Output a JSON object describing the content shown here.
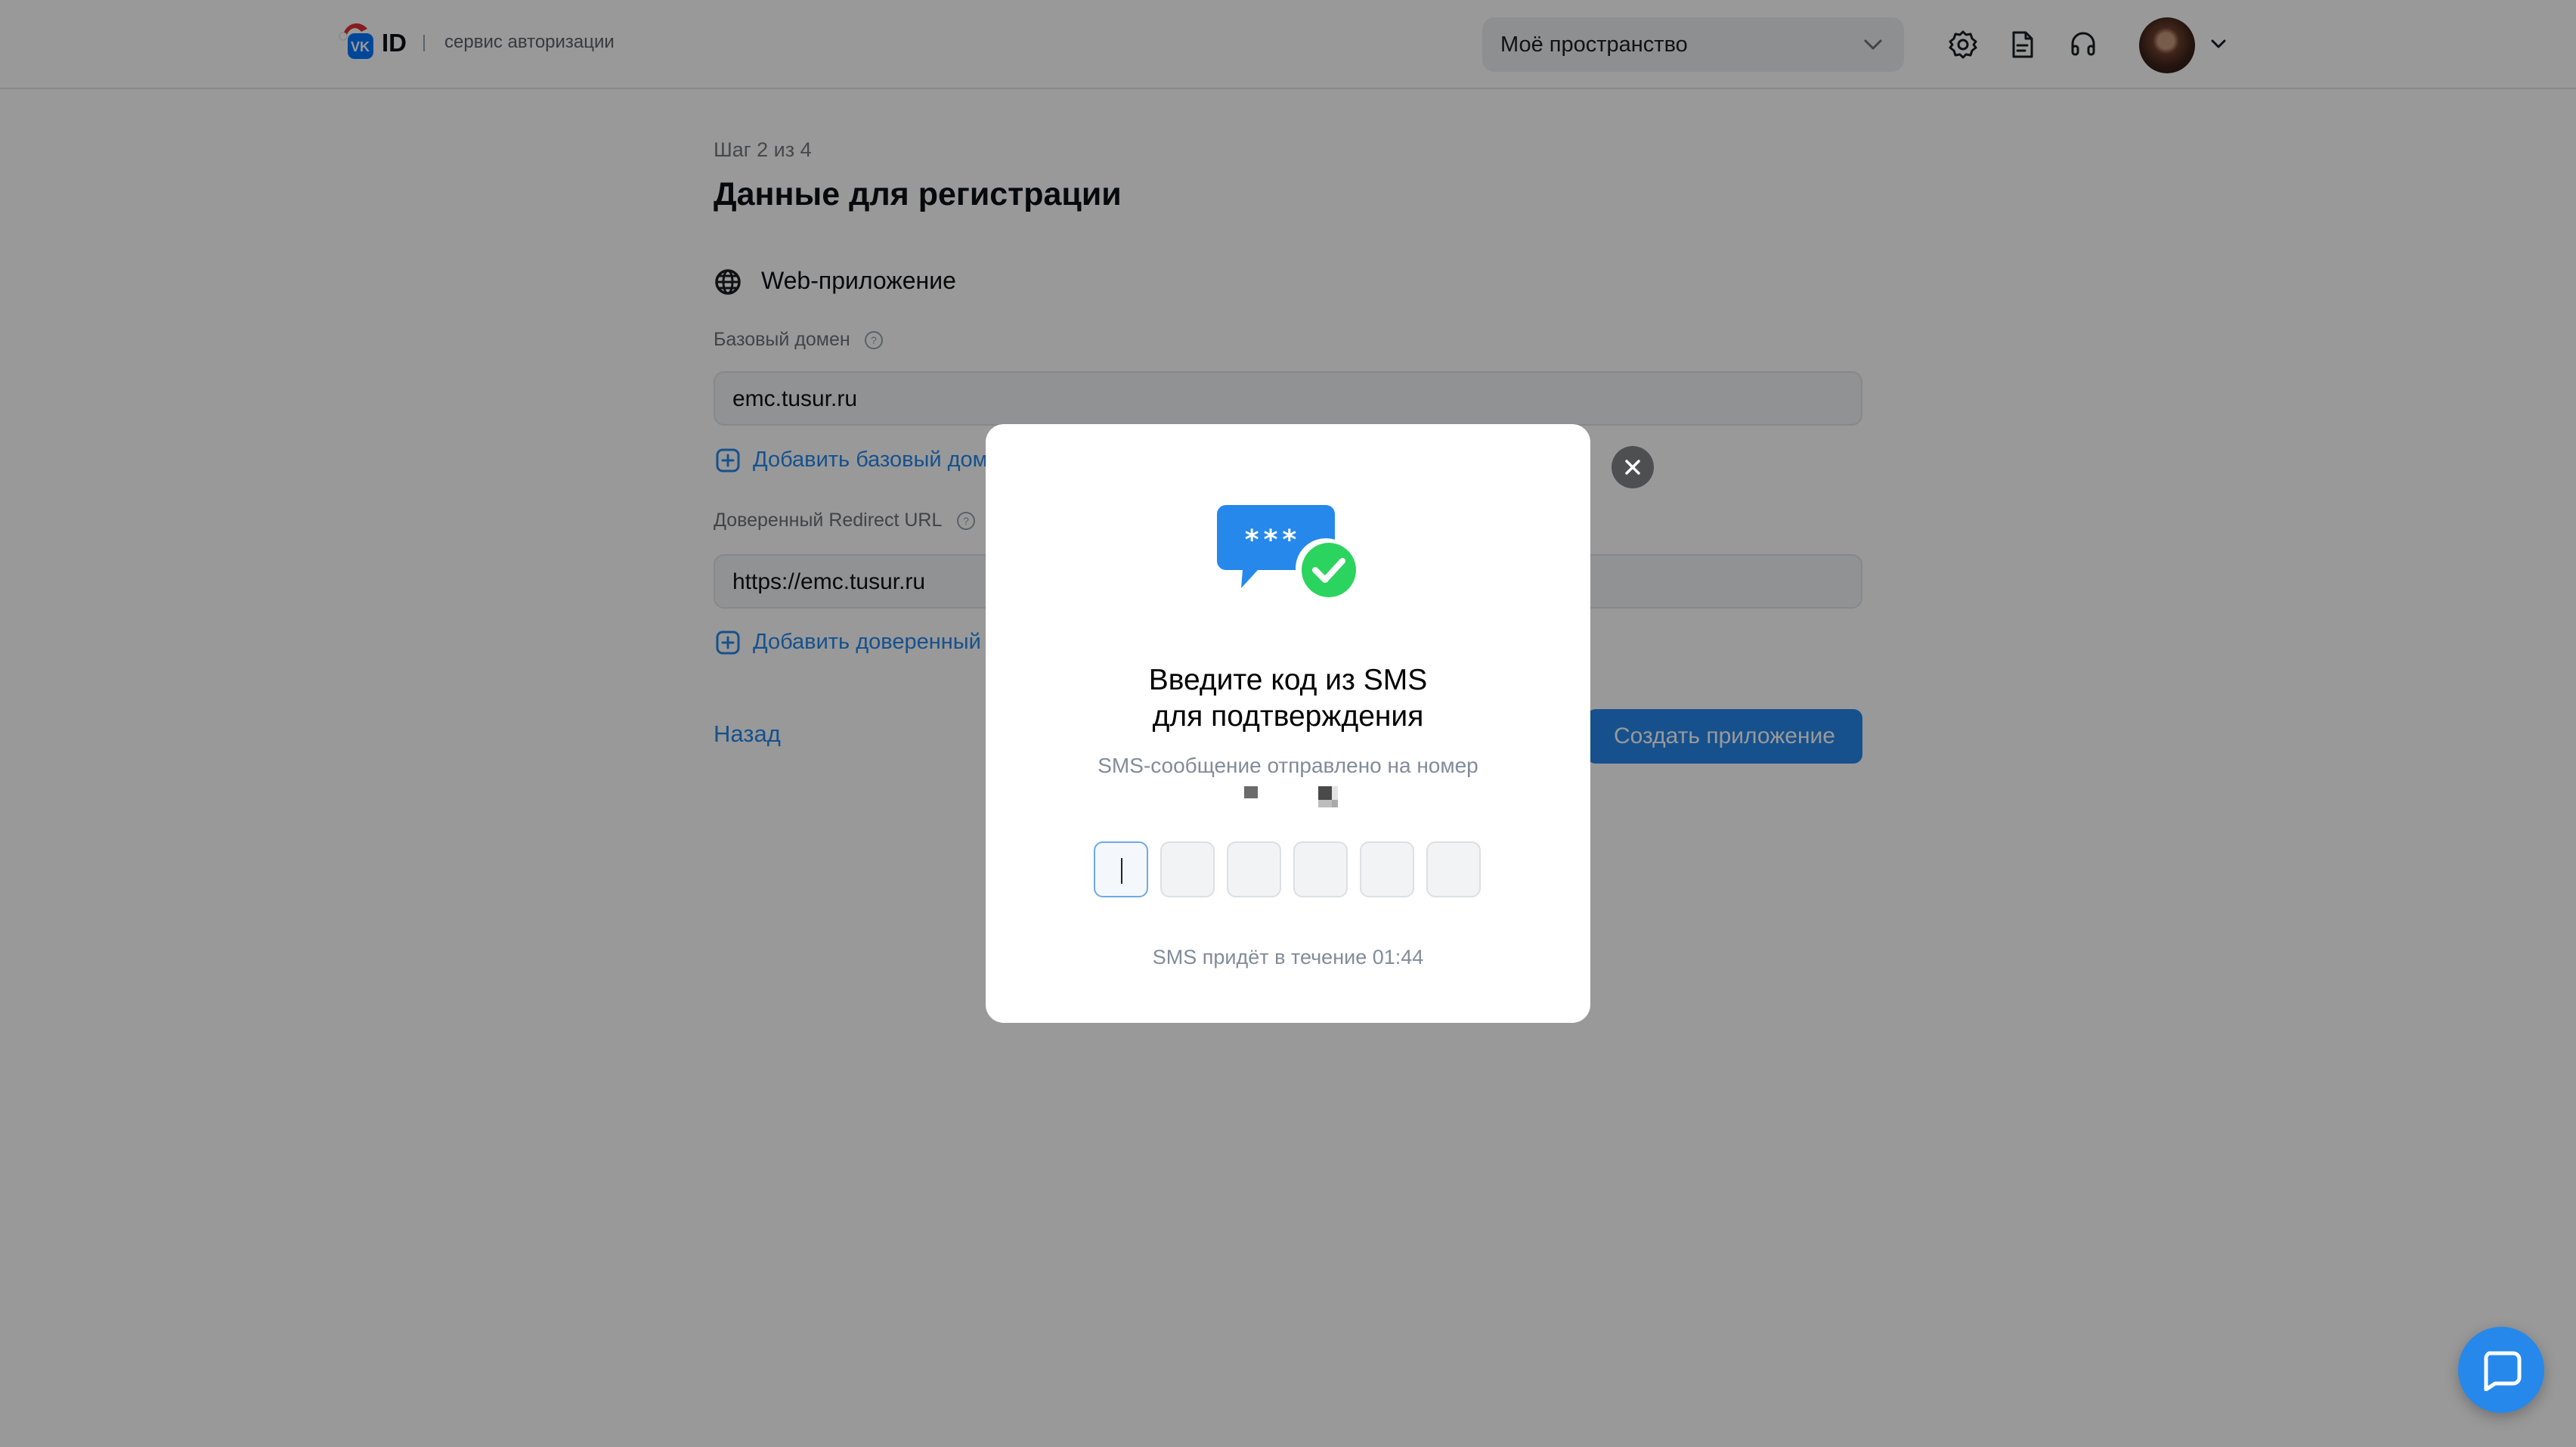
{
  "header": {
    "logo_text": "ID",
    "logo_subtitle": "сервис авторизации",
    "space_select": {
      "value": "Моё пространство"
    },
    "icons": [
      "gear-icon",
      "document-icon",
      "headset-icon"
    ],
    "avatar": "user-avatar"
  },
  "main": {
    "step": "Шаг 2 из 4",
    "title": "Данные для регистрации",
    "section_title": "Web-приложение",
    "base_domain": {
      "label": "Базовый домен",
      "value": "emc.tusur.ru",
      "add_link": "Добавить базовый домен"
    },
    "redirect": {
      "label": "Доверенный Redirect URL",
      "value": "https://emc.tusur.ru",
      "add_link": "Добавить доверенный Redirect URL"
    },
    "back": "Назад",
    "create": "Создать приложение"
  },
  "modal": {
    "title_line1": "Введите код из SMS",
    "title_line2": "для подтверждения",
    "subtitle": "SMS-сообщение отправлено на номер",
    "code_length": 6,
    "timer_text": "SMS придёт в течение 01:44"
  },
  "colors": {
    "accent": "#2688eb",
    "overlay": "rgba(0,0,0,0.40)",
    "success": "#2bd45f"
  }
}
